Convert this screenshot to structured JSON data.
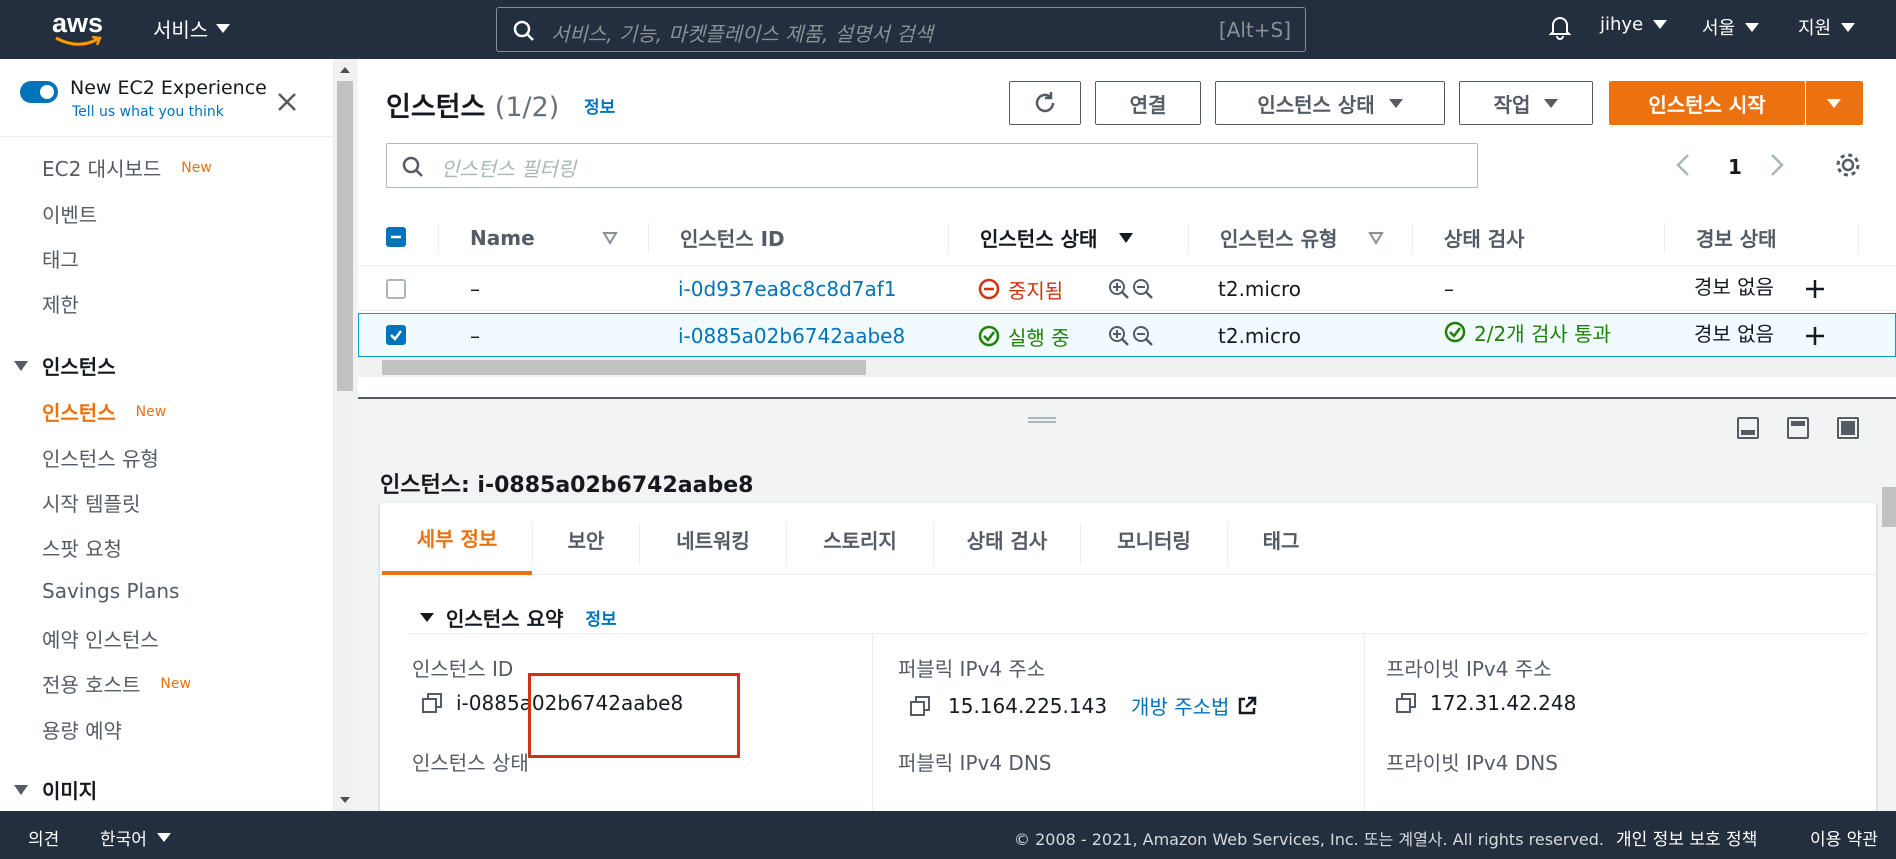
{
  "topnav": {
    "logo": "aws",
    "services_label": "서비스",
    "search_placeholder": "서비스, 기능, 마켓플레이스 제품, 설명서 검색",
    "search_shortcut": "[Alt+S]",
    "user": "jihye",
    "region": "서울",
    "support": "지원"
  },
  "sidebar": {
    "new_experience_title": "New EC2 Experience",
    "new_experience_sub": "Tell us what you think",
    "new_badge": "New",
    "items_top": [
      "EC2 대시보드",
      "이벤트",
      "태그",
      "제한"
    ],
    "section_instances": "인스턴스",
    "instances_items": [
      "인스턴스",
      "인스턴스 유형",
      "시작 템플릿",
      "스팟 요청",
      "Savings Plans",
      "예약 인스턴스",
      "전용 호스트",
      "용량 예약"
    ],
    "section_images": "이미지"
  },
  "header": {
    "title": "인스턴스",
    "count": "(1/2)",
    "info": "정보",
    "connect": "연결",
    "state": "인스턴스 상태",
    "actions": "작업",
    "launch": "인스턴스 시작",
    "filter_placeholder": "인스턴스 필터링",
    "page": "1"
  },
  "table": {
    "columns": [
      "Name",
      "인스턴스 ID",
      "인스턴스 상태",
      "인스턴스 유형",
      "상태 검사",
      "경보 상태"
    ],
    "rows": [
      {
        "name": "–",
        "id": "i-0d937ea8c8c8d7af1",
        "state": "중지됨",
        "type": "t2.micro",
        "check": "–",
        "alarm": "경보 없음",
        "selected": false
      },
      {
        "name": "–",
        "id": "i-0885a02b6742aabe8",
        "state": "실행 중",
        "type": "t2.micro",
        "check": "2/2개 검사 통과",
        "alarm": "경보 없음",
        "selected": true
      }
    ]
  },
  "details": {
    "title": "인스턴스: i-0885a02b6742aabe8",
    "tabs": [
      "세부 정보",
      "보안",
      "네트워킹",
      "스토리지",
      "상태 검사",
      "모니터링",
      "태그"
    ],
    "section": "인스턴스 요약",
    "section_info": "정보",
    "instance_id_label": "인스턴스 ID",
    "instance_id": "i-0885a02b6742aabe8",
    "public_ip_label": "퍼블릭 IPv4 주소",
    "public_ip": "15.164.225.143",
    "open_address": "개방 주소법",
    "private_ip_label": "프라이빗 IPv4 주소",
    "private_ip": "172.31.42.248",
    "instance_state_label": "인스턴스 상태",
    "public_dns_label": "퍼블릭 IPv4 DNS",
    "private_dns_label": "프라이빗 IPv4 DNS"
  },
  "footer": {
    "feedback": "의견",
    "language": "한국어",
    "copyright": "© 2008 - 2021, Amazon Web Services, Inc. 또는 계열사. All rights reserved.",
    "privacy": "개인 정보 보호 정책",
    "terms": "이용 약관"
  },
  "colors": {
    "nav_bg": "#232f3e",
    "accent_orange": "#ec7211",
    "link_blue": "#0073bb",
    "stopped_red": "#d13212",
    "running_green": "#1d8102"
  }
}
